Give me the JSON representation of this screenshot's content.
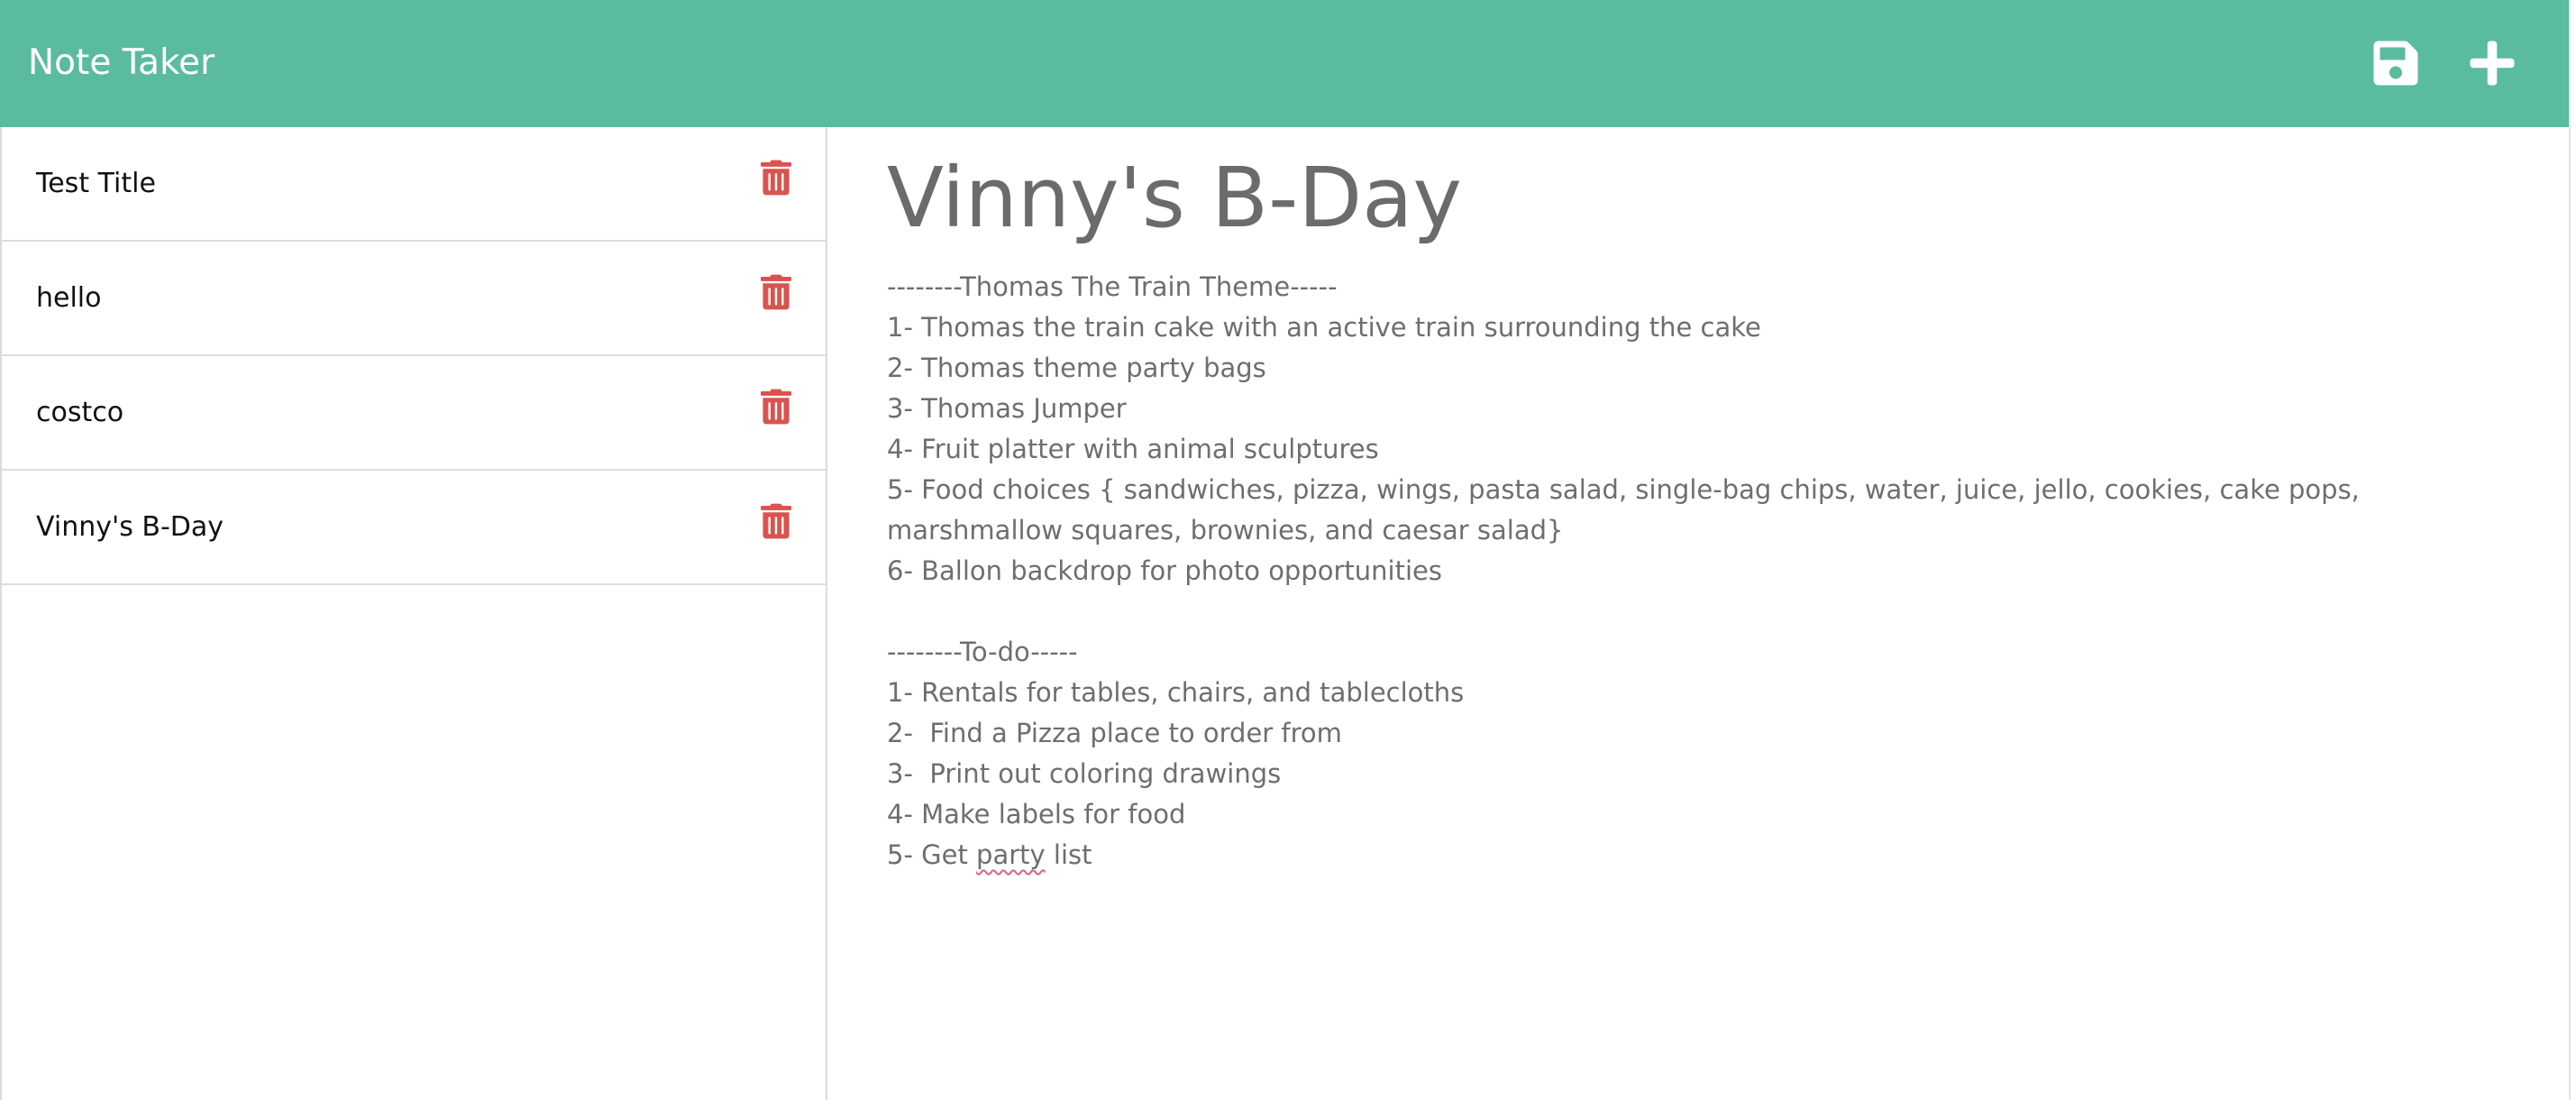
{
  "app": {
    "title": "Note Taker"
  },
  "toolbar": {
    "save_icon": "save-icon",
    "new_icon": "plus-icon"
  },
  "colors": {
    "navbar": "#5abb9e",
    "delete": "#d9534f",
    "text": "#6e6e6e"
  },
  "notes": [
    {
      "title": "Test Title"
    },
    {
      "title": "hello"
    },
    {
      "title": "costco"
    },
    {
      "title": "Vinny's B-Day"
    }
  ],
  "active_note": {
    "title": "Vinny's B-Day",
    "lines": [
      "--------Thomas The Train Theme-----",
      "1- Thomas the train cake with an active train surrounding the cake",
      "2- Thomas theme party bags",
      "3- Thomas Jumper",
      "4- Fruit platter with animal sculptures",
      "5- Food choices { sandwiches, pizza, wings, pasta salad, single-bag chips, water, juice, jello, cookies, cake pops, marshmallow squares, brownies, and caesar salad}",
      "6- Ballon backdrop for photo opportunities",
      "",
      "--------To-do-----",
      "1- Rentals for tables, chairs, and tablecloths",
      "2-  Find a Pizza place to order from",
      "3-  Print out coloring drawings",
      "4- Make labels for food",
      "5- Get ",
      "party",
      " list"
    ]
  }
}
